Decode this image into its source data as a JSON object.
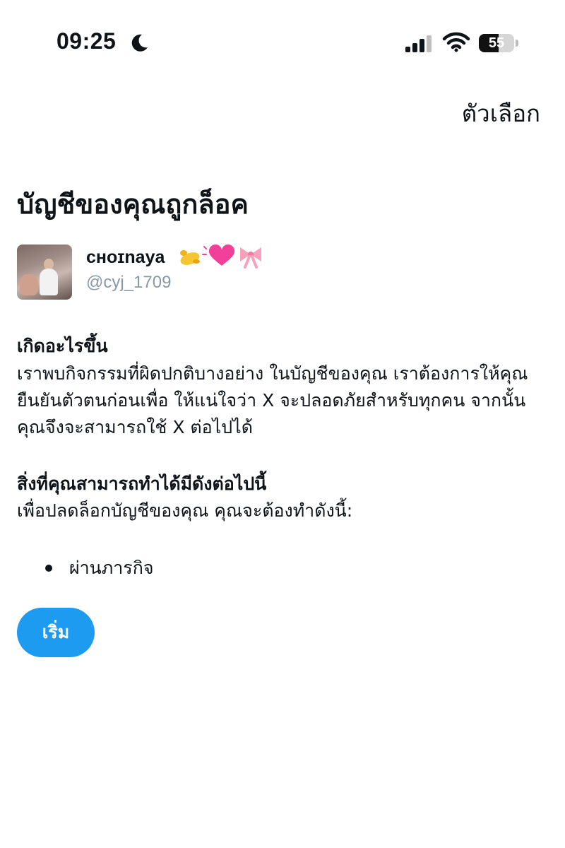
{
  "status_bar": {
    "time": "09:25",
    "battery_level": "55",
    "battery_fraction": 0.55,
    "icons": [
      "moon-icon",
      "signal-icon",
      "wifi-icon",
      "battery-icon"
    ]
  },
  "header": {
    "options_label": "ตัวเลือก"
  },
  "page": {
    "title": "บัญชีของคุณถูกล็อค"
  },
  "account": {
    "display_name": "cʜᴏɪnaya",
    "name_emojis": [
      "pinching-hand-emoji",
      "beating-heart-emoji",
      "ribbon-emoji"
    ],
    "handle": "@cyj_1709"
  },
  "what_happened": {
    "heading": "เกิดอะไรขึ้น",
    "text": "เราพบกิจกรรมที่ผิดปกติบางอย่าง ในบัญชีของคุณ เราต้องการให้คุณยืนยันตัวตนก่อนเพื่อ ให้แน่ใจว่า X จะปลอดภัยสำหรับทุกคน จากนั้นคุณจึงจะสามารถใช้ X ต่อไปได้"
  },
  "what_you_can_do": {
    "heading": "สิ่งที่คุณสามารถทำได้มีดังต่อไปนี้",
    "text": "เพื่อปลดล็อกบัญชีของคุณ คุณจะต้องทำดังนี้:",
    "steps": [
      "ผ่านภารกิจ"
    ]
  },
  "actions": {
    "start_label": "เริ่ม",
    "accent_color": "#1d9bf0"
  }
}
